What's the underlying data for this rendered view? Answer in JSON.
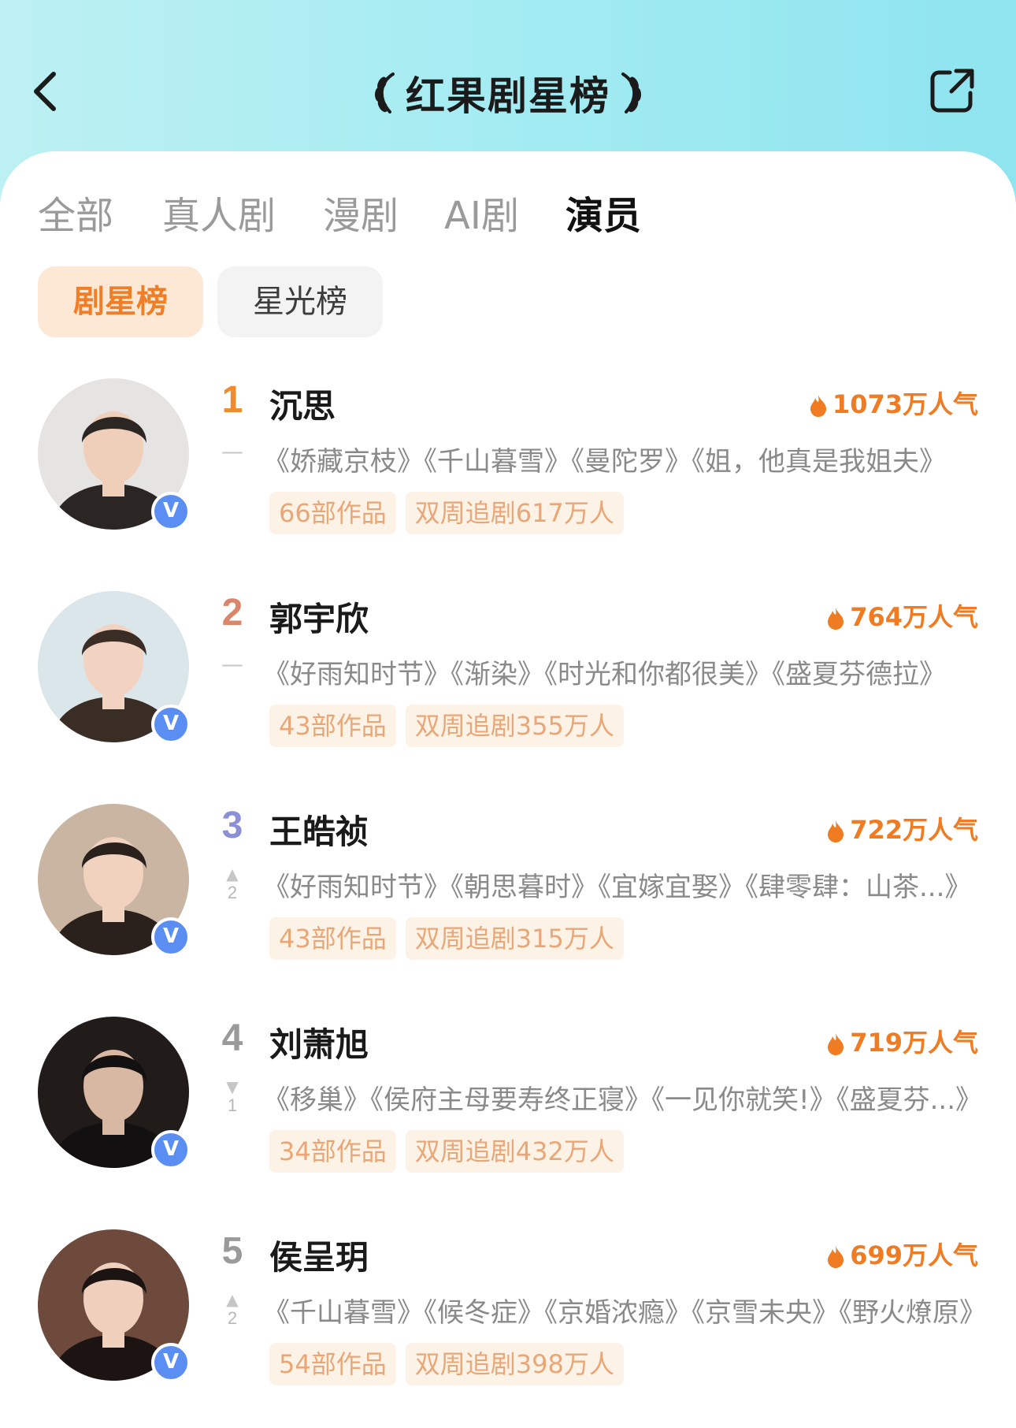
{
  "header": {
    "title": "红果剧星榜"
  },
  "tabs": [
    {
      "label": "全部",
      "active": false
    },
    {
      "label": "真人剧",
      "active": false
    },
    {
      "label": "漫剧",
      "active": false
    },
    {
      "label": "AI剧",
      "active": false
    },
    {
      "label": "演员",
      "active": true
    }
  ],
  "subtabs": [
    {
      "label": "剧星榜",
      "active": true
    },
    {
      "label": "星光榜",
      "active": false
    }
  ],
  "colors": {
    "accent": "#ef7b23",
    "rank1": "#f08a2a",
    "rank2": "#d9866a",
    "rank3": "#8b8fd6",
    "rank_other": "#9a9a9a",
    "badge": "#5b8ef2"
  },
  "ranking": [
    {
      "rank": "1",
      "name": "沉思",
      "popularity": "1073万人气",
      "trend": "none",
      "trend_value": "",
      "works": "《娇藏京枝》《千山暮雪》《曼陀罗》《姐，他真是我姐夫》",
      "tag_works": "66部作品",
      "tag_followers": "双周追剧617万人",
      "verified_icon": "v-badge-icon",
      "badge_label": "V"
    },
    {
      "rank": "2",
      "name": "郭宇欣",
      "popularity": "764万人气",
      "trend": "none",
      "trend_value": "",
      "works": "《好雨知时节》《渐染》《时光和你都很美》《盛夏芬德拉》",
      "tag_works": "43部作品",
      "tag_followers": "双周追剧355万人",
      "verified_icon": "v-badge-icon",
      "badge_label": "V"
    },
    {
      "rank": "3",
      "name": "王皓祯",
      "popularity": "722万人气",
      "trend": "up",
      "trend_value": "2",
      "works": "《好雨知时节》《朝思暮时》《宜嫁宜娶》《肆零肆：山茶...》",
      "tag_works": "43部作品",
      "tag_followers": "双周追剧315万人",
      "verified_icon": "v-badge-icon",
      "badge_label": "V"
    },
    {
      "rank": "4",
      "name": "刘萧旭",
      "popularity": "719万人气",
      "trend": "down",
      "trend_value": "1",
      "works": "《移巢》《侯府主母要寿终正寝》《一见你就笑!》《盛夏芬...》",
      "tag_works": "34部作品",
      "tag_followers": "双周追剧432万人",
      "verified_icon": "v-badge-icon",
      "badge_label": "V"
    },
    {
      "rank": "5",
      "name": "侯呈玥",
      "popularity": "699万人气",
      "trend": "up",
      "trend_value": "2",
      "works": "《千山暮雪》《候冬症》《京婚浓瘾》《京雪未央》《野火燎原》",
      "tag_works": "54部作品",
      "tag_followers": "双周追剧398万人",
      "verified_icon": "v-badge-icon",
      "badge_label": "V"
    }
  ]
}
